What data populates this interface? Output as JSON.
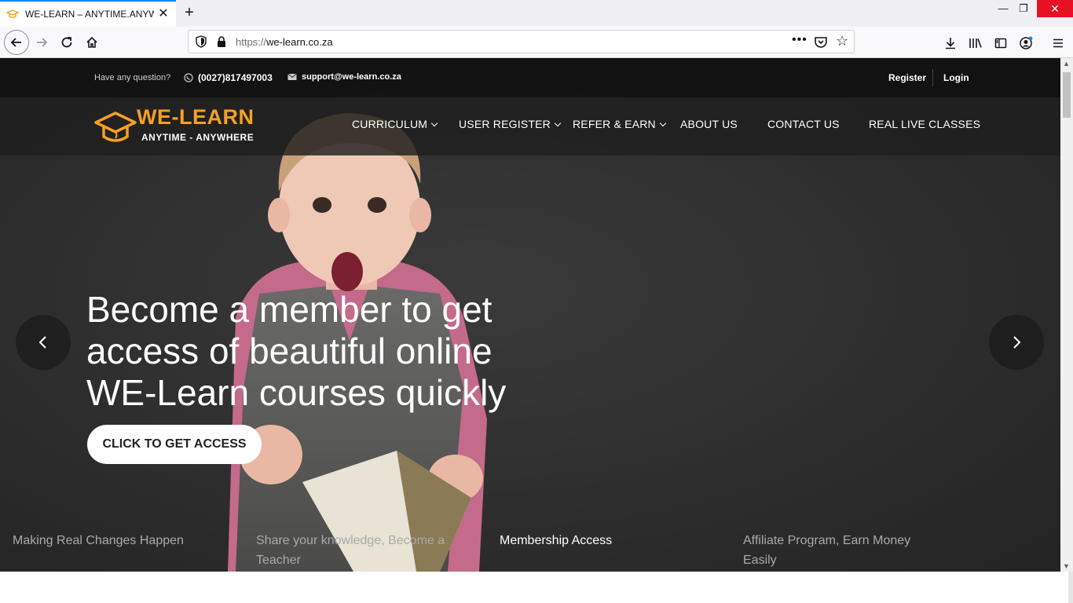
{
  "browser": {
    "tab_title": "WE-LEARN – ANYTIME.ANYWH",
    "url_proto": "https://",
    "url_host": "we-learn.co.za"
  },
  "topbar": {
    "question": "Have any question?",
    "phone": "(0027)817497003",
    "email": "support@we-learn.co.za",
    "register": "Register",
    "login": "Login"
  },
  "logo": {
    "name": "WE-LEARN",
    "tagline": "ANYTIME - ANYWHERE",
    "accent_color": "#f5a023"
  },
  "nav": {
    "items": [
      {
        "label": "CURRICULUM",
        "dropdown": true
      },
      {
        "label": "USER REGISTER",
        "dropdown": true
      },
      {
        "label": "REFER & EARN",
        "dropdown": true
      },
      {
        "label": "ABOUT US",
        "dropdown": false
      },
      {
        "label": "CONTACT US",
        "dropdown": false
      },
      {
        "label": "REAL LIVE CLASSES",
        "dropdown": false
      }
    ]
  },
  "hero": {
    "title": "Become a member to get access of beautiful online WE-Learn courses quickly",
    "cta": "CLICK TO GET ACCESS"
  },
  "features": [
    {
      "label": "Making Real Changes Happen",
      "active": false
    },
    {
      "label": "Share your knowledge, Become a Teacher",
      "active": false
    },
    {
      "label": "Membership Access",
      "active": true
    },
    {
      "label": "Affiliate Program, Earn Money Easily",
      "active": false
    }
  ]
}
